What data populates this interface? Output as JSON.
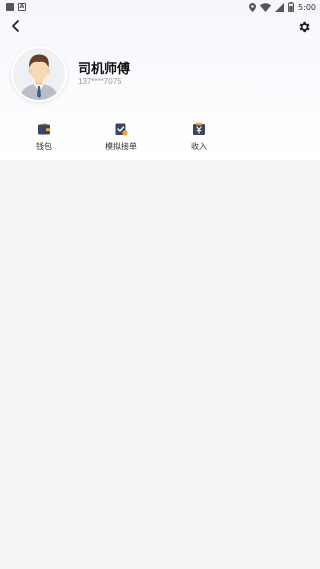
{
  "status_bar": {
    "time": "5:00",
    "icons": [
      "app-square-icon",
      "a-box-icon",
      "location-icon",
      "wifi-icon",
      "signal-icon",
      "battery-icon"
    ]
  },
  "header": {
    "back_icon": "chevron-left-icon",
    "settings_icon": "gear-icon"
  },
  "profile": {
    "name": "司机师傅",
    "phone": "137****7075",
    "avatar_icon": "male-driver-avatar"
  },
  "actions": [
    {
      "label": "钱包",
      "icon": "wallet-icon"
    },
    {
      "label": "模拟接单",
      "icon": "clipboard-check-icon"
    },
    {
      "label": "收入",
      "icon": "yen-income-icon"
    }
  ],
  "colors": {
    "icon_dark": "#3c4466",
    "icon_accent": "#f5a623",
    "background": "#f5f5f5"
  }
}
